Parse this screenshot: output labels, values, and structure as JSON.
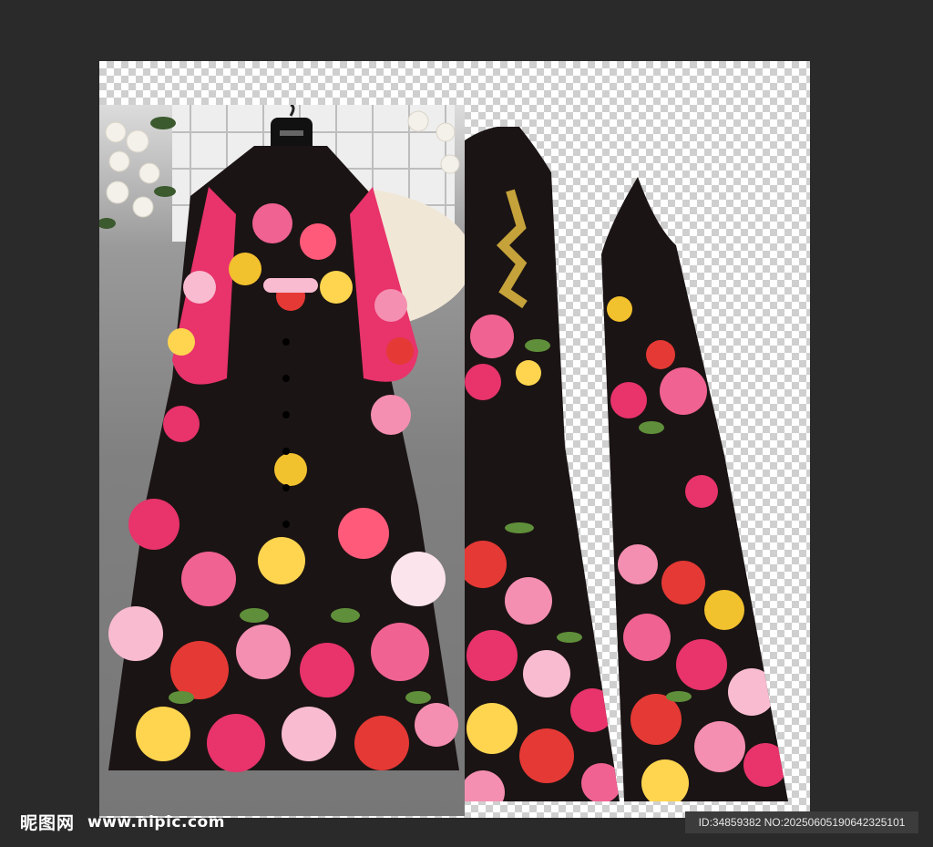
{
  "watermark": {
    "logo_text": "昵图网",
    "url_text": "www.nipic.com"
  },
  "image_id": {
    "text": "ID:34859382 NO:20250605190642325101"
  },
  "colors": {
    "background": "#2a2a2a",
    "transparency_checker": "#cfcfcf",
    "dress_base": "#1b1414",
    "flower_pink": "#e8336b",
    "flower_red": "#d0202c",
    "flower_yellow": "#f2c12e",
    "leaf_green": "#5f8f3a"
  },
  "icons": [
    "hanger-icon"
  ]
}
